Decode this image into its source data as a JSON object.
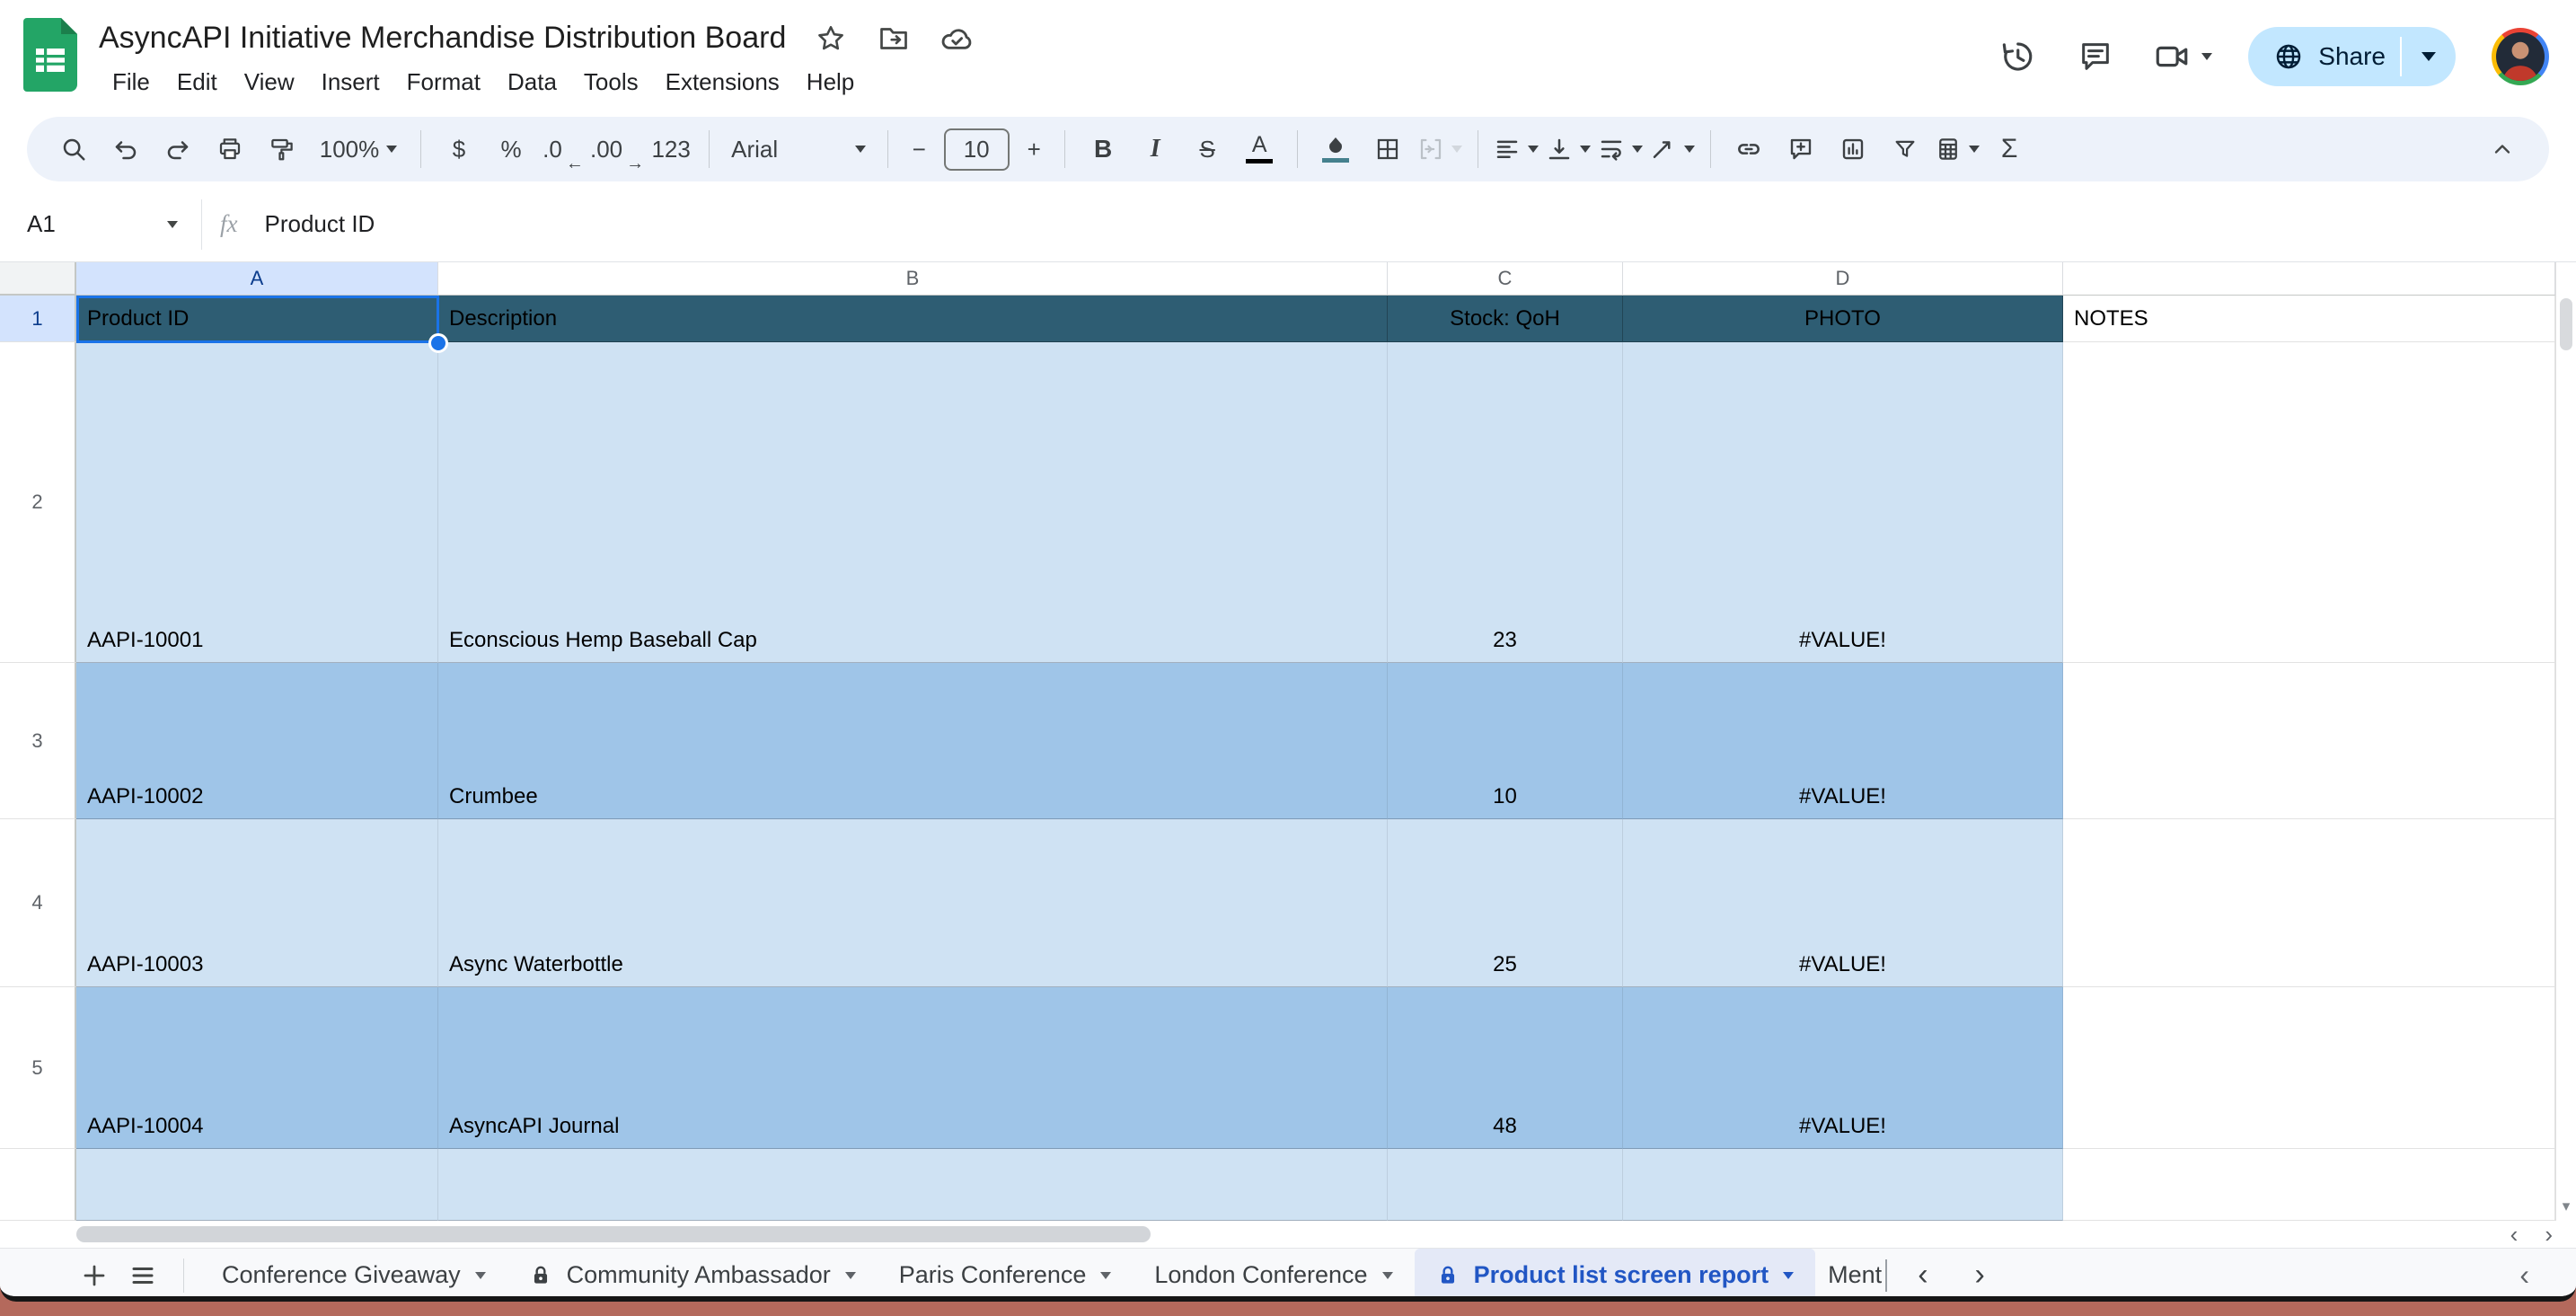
{
  "header": {
    "title": "AsyncAPI Initiative Merchandise Distribution Board",
    "menu": [
      "File",
      "Edit",
      "View",
      "Insert",
      "Format",
      "Data",
      "Tools",
      "Extensions",
      "Help"
    ],
    "share_label": "Share"
  },
  "toolbar": {
    "zoom": "100%",
    "currency": "$",
    "percent": "%",
    "dec_decrease": ".0",
    "dec_increase": ".00",
    "dec_arrow_left": "←",
    "dec_arrow_right": "→",
    "number_format": "123",
    "font_family": "Arial",
    "minus": "−",
    "font_size": "10",
    "plus": "+",
    "bold": "B",
    "italic": "I",
    "strikethrough": "S",
    "text_color": "A",
    "functions": "Σ"
  },
  "formula_bar": {
    "cell_ref": "A1",
    "fx_label": "fx",
    "value": "Product ID"
  },
  "grid": {
    "column_letters": [
      "A",
      "B",
      "C",
      "D",
      ""
    ],
    "row_numbers": [
      "1",
      "2",
      "3",
      "4",
      "5"
    ],
    "header_row": [
      "Product ID",
      "Description",
      "Stock: QoH",
      "PHOTO",
      "NOTES"
    ],
    "rows": [
      [
        "AAPI-10001",
        "Econscious Hemp Baseball Cap",
        "23",
        "#VALUE!",
        ""
      ],
      [
        "AAPI-10002",
        "Crumbee",
        "10",
        "#VALUE!",
        ""
      ],
      [
        "AAPI-10003",
        "Async Waterbottle",
        "25",
        "#VALUE!",
        ""
      ],
      [
        "AAPI-10004",
        "AsyncAPI Journal",
        "48",
        "#VALUE!",
        ""
      ]
    ],
    "colors": {
      "header_band": "#2e5d73",
      "row_light": "#cfe2f3",
      "row_dark": "#9fc5e8",
      "selection": "#1a73e8",
      "selected_header": "#d3e3fd"
    }
  },
  "scrollbars": {
    "v_down_arrow": "▾",
    "h_left_arrow": "‹",
    "h_right_arrow": "›"
  },
  "sheet_tabs": {
    "add": "+",
    "tabs": [
      {
        "label": "Conference Giveaway",
        "locked": false,
        "active": false
      },
      {
        "label": "Community Ambassador",
        "locked": true,
        "active": false
      },
      {
        "label": "Paris Conference",
        "locked": false,
        "active": false
      },
      {
        "label": "London Conference",
        "locked": false,
        "active": false
      },
      {
        "label": "Product list screen report",
        "locked": true,
        "active": true
      }
    ],
    "partial_tab": "Ment",
    "nav_prev": "‹",
    "nav_next": "›",
    "collapse_right": "‹",
    "active_color": "#2156c4"
  }
}
